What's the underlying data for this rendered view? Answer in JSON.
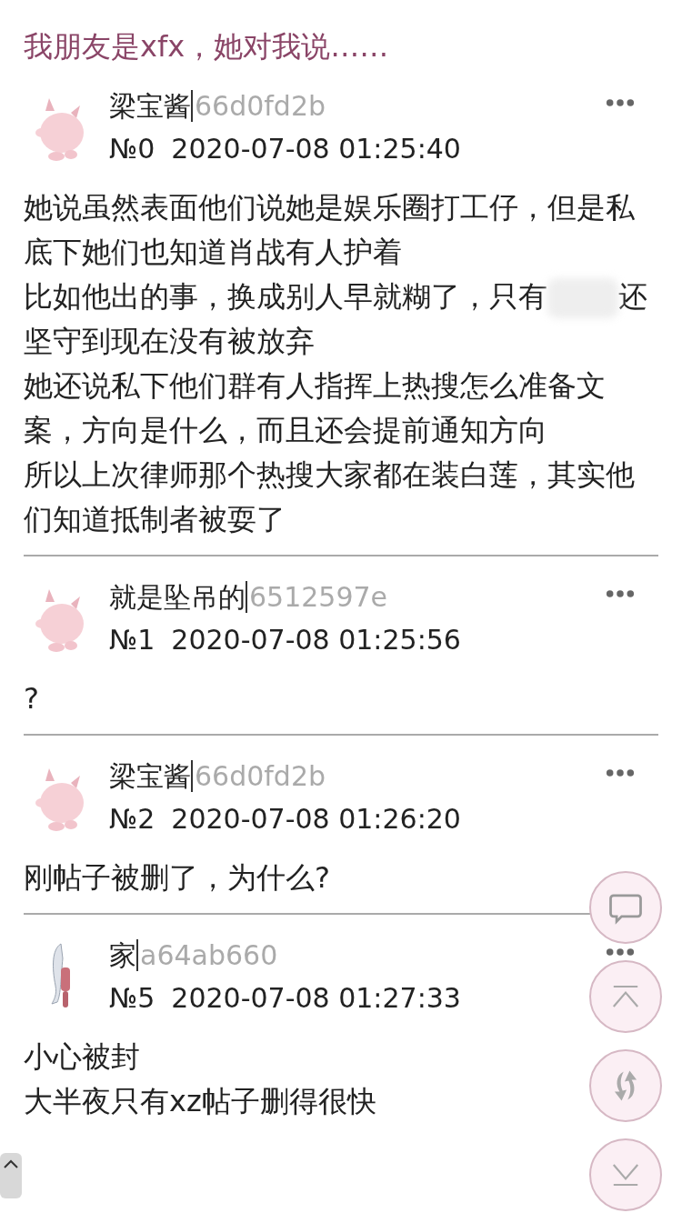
{
  "title": "我朋友是xfx，她对我说……",
  "posts": [
    {
      "avatar": {
        "kind": "pink"
      },
      "name": "梁宝酱",
      "id": "66d0fd2b",
      "number": "№0",
      "time": "2020-07-08 01:25:40",
      "body": [
        {
          "kind": "text",
          "text": "她说虽然表面他们说她是娱乐圈打工仔，但是私底下她们也知道肖战有人护着"
        },
        {
          "kind": "redacted",
          "before": "比如他出的事，换成别人早就糊了，只有",
          "after": "还"
        },
        {
          "kind": "text",
          "text": "坚守到现在没有被放弃"
        },
        {
          "kind": "text",
          "text": "她还说私下他们群有人指挥上热搜怎么准备文案，方向是什么，而且还会提前通知方向"
        },
        {
          "kind": "text",
          "text": "所以上次律师那个热搜大家都在装白莲，其实他们知道抵制者被耍了"
        }
      ]
    },
    {
      "avatar": {
        "kind": "pink"
      },
      "name": "就是坠吊的",
      "id": "6512597e",
      "number": "№1",
      "time": "2020-07-08 01:25:56",
      "body": [
        {
          "kind": "text",
          "text": "?"
        }
      ]
    },
    {
      "avatar": {
        "kind": "pink"
      },
      "name": "梁宝酱",
      "id": "66d0fd2b",
      "number": "№2",
      "time": "2020-07-08 01:26:20",
      "body": [
        {
          "kind": "text",
          "text": "刚帖子被删了，为什么?"
        }
      ]
    },
    {
      "avatar": {
        "kind": "slim"
      },
      "name": "家",
      "id": "a64ab660",
      "number": "№5",
      "time": "2020-07-08 01:27:33",
      "body": [
        {
          "kind": "text",
          "text": "小心被封"
        },
        {
          "kind": "text",
          "text": "大半夜只有xz帖子删得很快"
        }
      ]
    }
  ],
  "float_buttons": [
    {
      "kind": "reply"
    },
    {
      "kind": "top"
    },
    {
      "kind": "refresh"
    },
    {
      "kind": "bottom"
    }
  ]
}
